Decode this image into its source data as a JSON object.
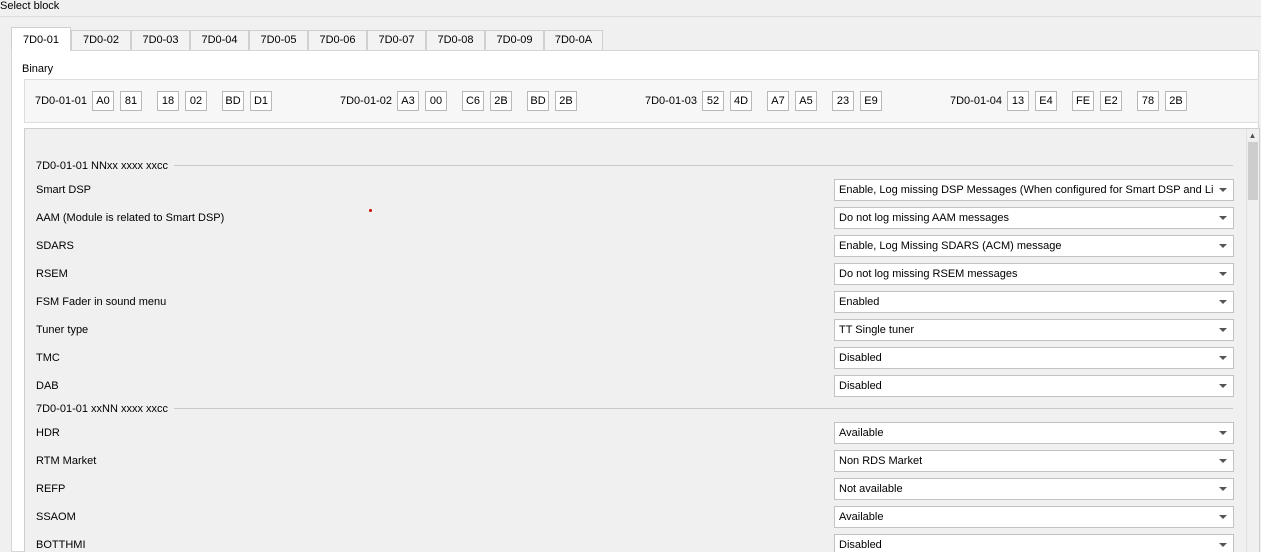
{
  "title": "Select block",
  "tabs": [
    "7D0-01",
    "7D0-02",
    "7D0-03",
    "7D0-04",
    "7D0-05",
    "7D0-06",
    "7D0-07",
    "7D0-08",
    "7D0-09",
    "7D0-0A"
  ],
  "binary_label": "Binary",
  "binary": [
    {
      "name": "7D0-01-01",
      "bytes": [
        "A0",
        "81",
        "18",
        "02",
        "BD",
        "D1"
      ]
    },
    {
      "name": "7D0-01-02",
      "bytes": [
        "A3",
        "00",
        "C6",
        "2B",
        "BD",
        "2B"
      ]
    },
    {
      "name": "7D0-01-03",
      "bytes": [
        "52",
        "4D",
        "A7",
        "A5",
        "23",
        "E9"
      ]
    },
    {
      "name": "7D0-01-04",
      "bytes": [
        "13",
        "E4",
        "FE",
        "E2",
        "78",
        "2B"
      ]
    }
  ],
  "sections": [
    {
      "title": "7D0-01-01 NNxx xxxx xxcc",
      "rows": [
        {
          "label": "Smart DSP",
          "value": "Enable, Log missing DSP Messages (When configured for Smart DSP and Lincol"
        },
        {
          "label": "AAM (Module is related to Smart DSP)",
          "value": "Do not log missing AAM messages"
        },
        {
          "label": "SDARS",
          "value": "Enable, Log Missing SDARS (ACM) message"
        },
        {
          "label": "RSEM",
          "value": "Do not log missing RSEM messages"
        },
        {
          "label": "FSM Fader in sound menu",
          "value": "Enabled"
        },
        {
          "label": "Tuner type",
          "value": "TT Single tuner"
        },
        {
          "label": "TMC",
          "value": "Disabled"
        },
        {
          "label": "DAB",
          "value": "Disabled"
        }
      ]
    },
    {
      "title": "7D0-01-01 xxNN xxxx xxcc",
      "rows": [
        {
          "label": "HDR",
          "value": "Available"
        },
        {
          "label": "RTM Market",
          "value": "Non RDS Market"
        },
        {
          "label": "REFP",
          "value": "Not available"
        },
        {
          "label": "SSAOM",
          "value": "Available"
        },
        {
          "label": "BOTTHMI",
          "value": "Disabled"
        }
      ]
    }
  ],
  "icons": {
    "dropdown": "chevron-down-icon",
    "scroll_up": "arrow-up-icon"
  }
}
